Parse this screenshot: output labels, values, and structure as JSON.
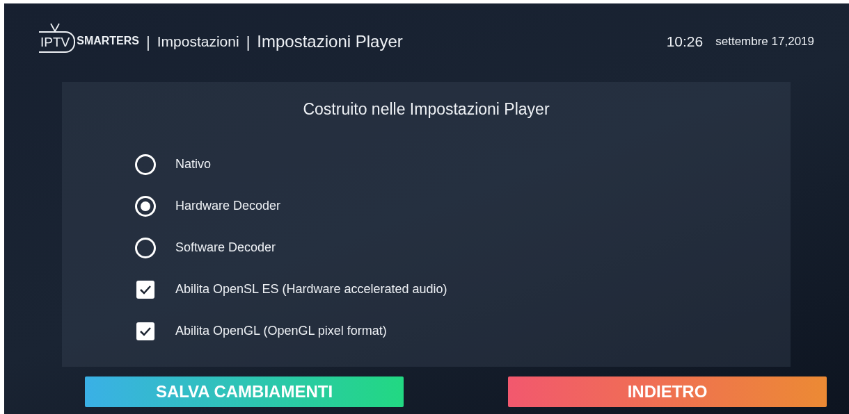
{
  "header": {
    "logo": {
      "left": "IPTV",
      "right": "SMARTERS"
    },
    "separator_1": "|",
    "section": "Impostazioni",
    "separator_2": "|",
    "page_title": "Impostazioni Player",
    "time": "10:26",
    "date": "settembre 17,2019"
  },
  "panel": {
    "title": "Costruito nelle Impostazioni Player",
    "options": [
      {
        "kind": "radio",
        "label": "Nativo",
        "selected": false
      },
      {
        "kind": "radio",
        "label": "Hardware Decoder",
        "selected": true
      },
      {
        "kind": "radio",
        "label": "Software Decoder",
        "selected": false
      },
      {
        "kind": "checkbox",
        "label": "Abilita OpenSL ES (Hardware accelerated audio)",
        "checked": true
      },
      {
        "kind": "checkbox",
        "label": "Abilita OpenGL (OpenGL pixel format)",
        "checked": true
      }
    ]
  },
  "buttons": [
    {
      "kind": "save",
      "label": "SALVA CAMBIAMENTI"
    },
    {
      "kind": "back",
      "label": "INDIETRO"
    }
  ]
}
